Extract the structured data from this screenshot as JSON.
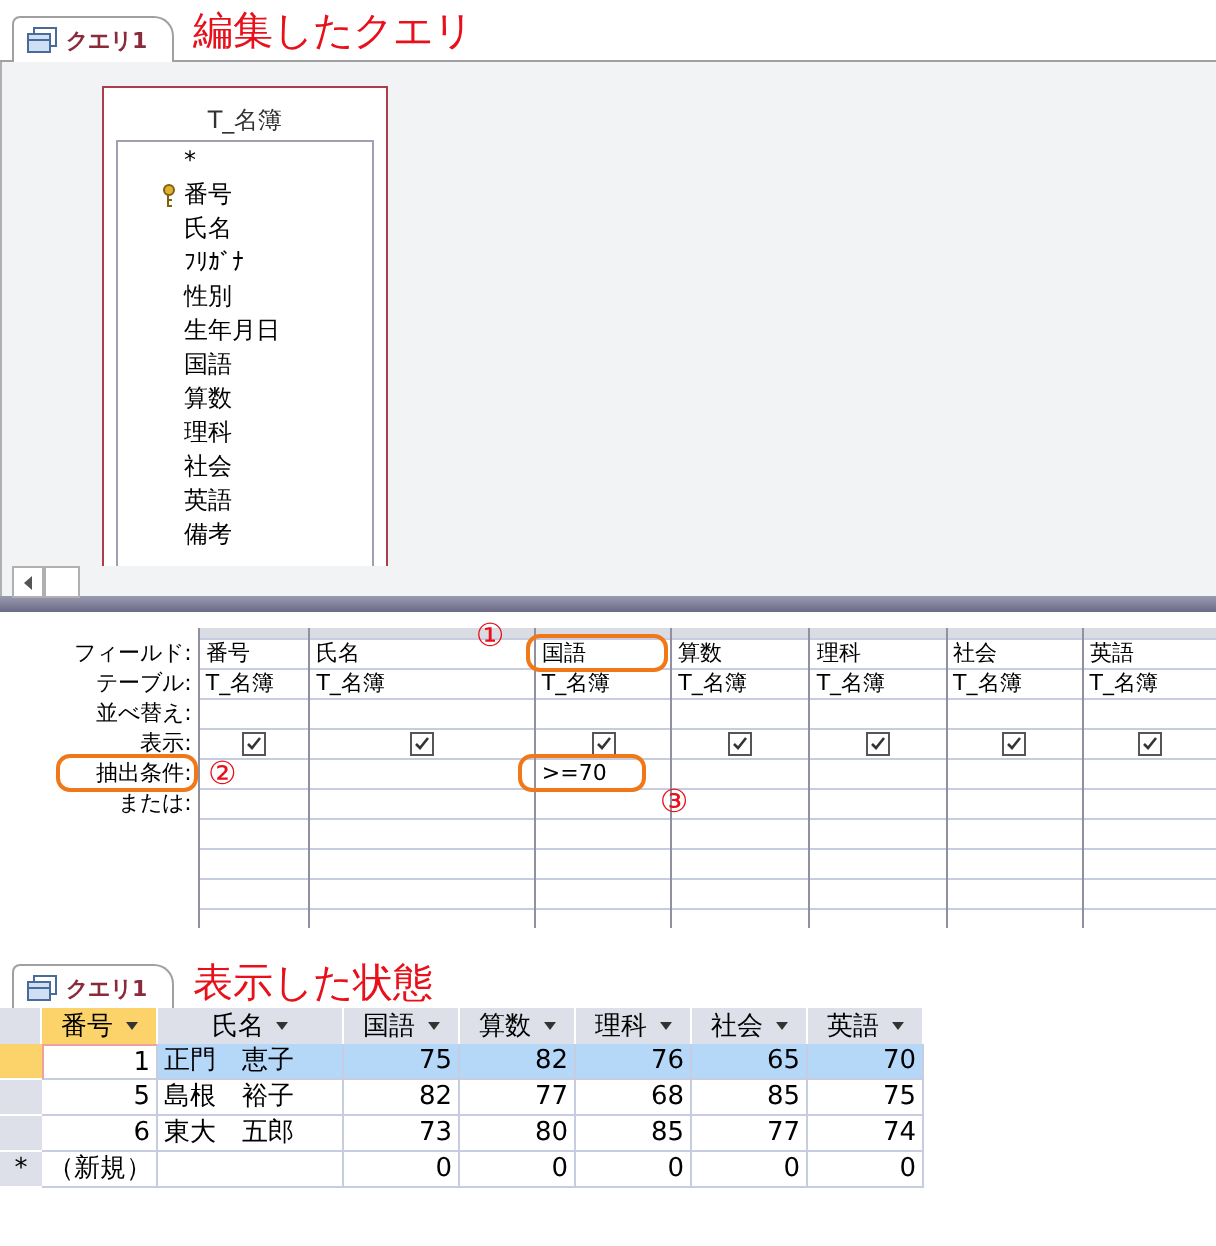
{
  "design_view": {
    "tab": {
      "label": "クエリ1",
      "selected": true
    },
    "heading": "編集したクエリ",
    "table_box": {
      "title": "T_名簿",
      "fields": [
        {
          "name": "*",
          "kind": "all"
        },
        {
          "name": "番号",
          "kind": "key"
        },
        {
          "name": "氏名",
          "kind": "plain"
        },
        {
          "name": "ﾌﾘｶﾞﾅ",
          "kind": "plain"
        },
        {
          "name": "性別",
          "kind": "plain"
        },
        {
          "name": "生年月日",
          "kind": "plain"
        },
        {
          "name": "国語",
          "kind": "plain"
        },
        {
          "name": "算数",
          "kind": "plain"
        },
        {
          "name": "理科",
          "kind": "plain"
        },
        {
          "name": "社会",
          "kind": "plain"
        },
        {
          "name": "英語",
          "kind": "plain"
        },
        {
          "name": "備考",
          "kind": "plain"
        }
      ]
    },
    "row_labels": [
      {
        "text": "フィールド:",
        "marked": false
      },
      {
        "text": "テーブル:",
        "marked": false
      },
      {
        "text": "並べ替え:",
        "marked": false
      },
      {
        "text": "表示:",
        "marked": false
      },
      {
        "text": "抽出条件:",
        "marked": true,
        "note": "②"
      },
      {
        "text": "または:",
        "marked": false
      }
    ],
    "columns": [
      {
        "field": "番号",
        "table": "T_名簿",
        "show": true,
        "marked": false
      },
      {
        "field": "氏名",
        "table": "T_名簿",
        "show": true,
        "marked": false
      },
      {
        "field": "国語",
        "table": "T_名簿",
        "show": true,
        "marked": true,
        "field_note": "①",
        "criteria": ">=70",
        "criteria_note": "③"
      },
      {
        "field": "算数",
        "table": "T_名簿",
        "show": true,
        "marked": false
      },
      {
        "field": "理科",
        "table": "T_名簿",
        "show": true,
        "marked": false
      },
      {
        "field": "社会",
        "table": "T_名簿",
        "show": true,
        "marked": false
      },
      {
        "field": "英語",
        "table": "T_名簿",
        "show": true,
        "marked": false
      }
    ]
  },
  "datasheet_view": {
    "tab": {
      "label": "クエリ1",
      "selected": true
    },
    "heading": "表示した状態",
    "columns": [
      {
        "label": "番号",
        "selected": true,
        "kind": "number"
      },
      {
        "label": "氏名",
        "selected": false,
        "kind": "text"
      },
      {
        "label": "国語",
        "selected": false,
        "kind": "number"
      },
      {
        "label": "算数",
        "selected": false,
        "kind": "number"
      },
      {
        "label": "理科",
        "selected": false,
        "kind": "number"
      },
      {
        "label": "社会",
        "selected": false,
        "kind": "number"
      },
      {
        "label": "英語",
        "selected": false,
        "kind": "number"
      }
    ],
    "rows": [
      {
        "selected": true,
        "cells": [
          "1",
          "正門　恵子",
          "75",
          "82",
          "76",
          "65",
          "70"
        ]
      },
      {
        "selected": false,
        "cells": [
          "5",
          "島根　裕子",
          "82",
          "77",
          "68",
          "85",
          "75"
        ]
      },
      {
        "selected": false,
        "cells": [
          "6",
          "東大　五郎",
          "73",
          "80",
          "85",
          "77",
          "74"
        ]
      }
    ],
    "new_row": {
      "marker": "*",
      "label": "（新規）",
      "values": [
        "0",
        "0",
        "0",
        "0",
        "0"
      ]
    }
  }
}
